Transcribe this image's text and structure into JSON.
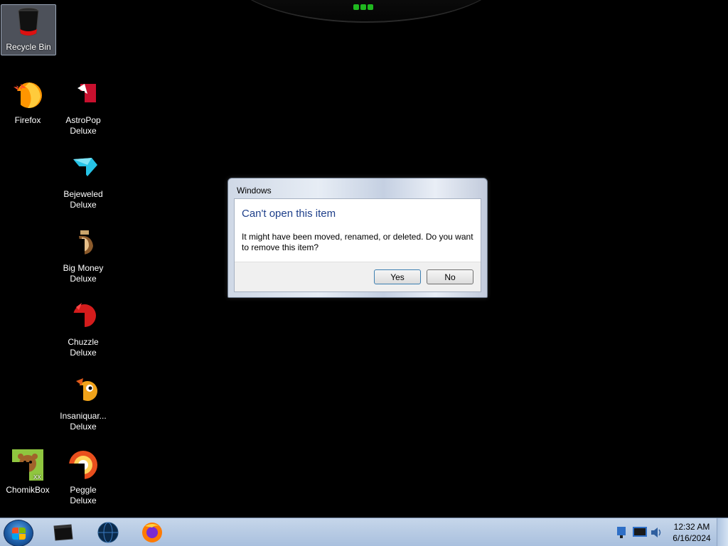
{
  "desktop": {
    "icons": [
      {
        "label": "Recycle Bin",
        "icon": "recycle-bin-icon"
      },
      {
        "label": "Firefox",
        "icon": "firefox-icon"
      },
      {
        "label": "AstroPop Deluxe",
        "icon": "astropop-icon"
      },
      {
        "label": "Bejeweled Deluxe",
        "icon": "bejeweled-icon"
      },
      {
        "label": "Big Money Deluxe",
        "icon": "big-money-icon"
      },
      {
        "label": "Chuzzle Deluxe",
        "icon": "chuzzle-icon"
      },
      {
        "label": "Insaniquar... Deluxe",
        "icon": "insaniquarium-icon"
      },
      {
        "label": "ChomikBox",
        "icon": "chomikbox-icon"
      },
      {
        "label": "Peggle Deluxe",
        "icon": "peggle-icon"
      }
    ]
  },
  "dialog": {
    "title": "Windows",
    "heading": "Can't open this item",
    "message": "It might have been moved, renamed, or deleted. Do you want to remove this item?",
    "yes_label": "Yes",
    "no_label": "No"
  },
  "taskbar": {
    "pinned": [
      "media-center-icon",
      "globe-icon",
      "firefox-icon"
    ],
    "tray_icons": [
      "network-icon",
      "monitor-icon",
      "volume-icon"
    ],
    "time": "12:32 AM",
    "date": "6/16/2024"
  },
  "colors": {
    "desktop_bg": "#000000",
    "dialog_heading": "#1e3f8a",
    "taskbar": "#b8cce6",
    "status_green": "#1fb81f"
  }
}
